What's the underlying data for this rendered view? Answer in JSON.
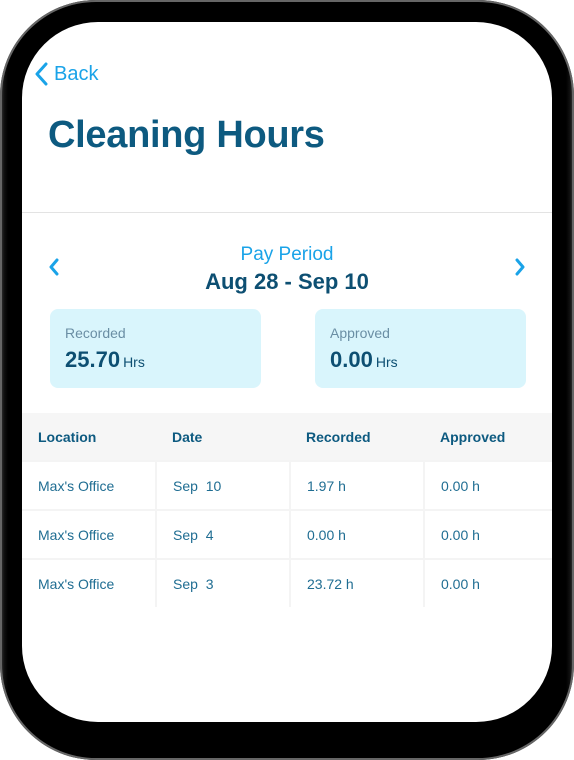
{
  "nav": {
    "back_label": "Back"
  },
  "header": {
    "title": "Cleaning Hours"
  },
  "pay_period": {
    "label": "Pay Period",
    "range": "Aug 28 - Sep 10"
  },
  "summary": {
    "recorded": {
      "label": "Recorded",
      "value": "25.70",
      "unit": "Hrs"
    },
    "approved": {
      "label": "Approved",
      "value": "0.00",
      "unit": "Hrs"
    }
  },
  "table": {
    "columns": [
      "Location",
      "Date",
      "Recorded",
      "Approved"
    ],
    "rows": [
      [
        "Max's Office",
        "Sep  10",
        "1.97 h",
        "0.00 h"
      ],
      [
        "Max's Office",
        "Sep  4",
        "0.00 h",
        "0.00 h"
      ],
      [
        "Max's Office",
        "Sep  3",
        "23.72 h",
        "0.00 h"
      ]
    ]
  },
  "colors": {
    "accent": "#1aa3e8",
    "title": "#0d5a80",
    "card_bg": "#d9f5fc"
  }
}
